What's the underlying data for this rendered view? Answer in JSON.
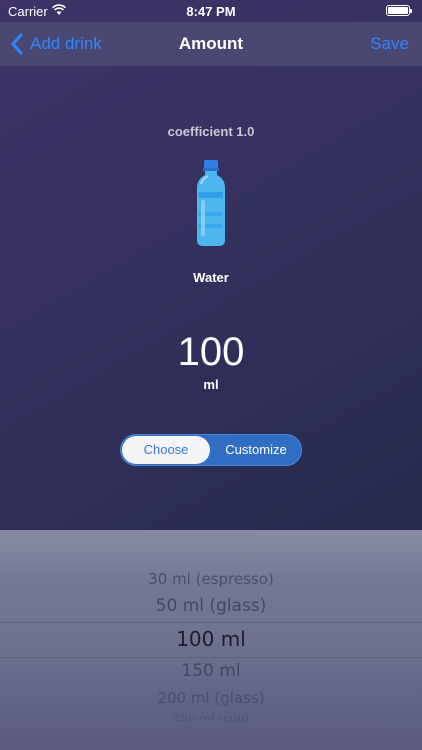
{
  "status_bar": {
    "carrier": "Carrier",
    "time": "8:47 PM"
  },
  "nav": {
    "back_label": "Add drink",
    "title": "Amount",
    "save_label": "Save"
  },
  "drink": {
    "coefficient": "coefficient 1.0",
    "name": "Water",
    "amount": "100",
    "unit": "ml"
  },
  "segmented": {
    "options": [
      "Choose",
      "Customize"
    ],
    "selected": "Choose"
  },
  "picker": {
    "items": [
      "30 ml (espresso)",
      "50 ml (glass)",
      "100 ml",
      "150 ml",
      "200 ml (glass)",
      "250 ml (cup)"
    ],
    "selected": "100 ml"
  },
  "colors": {
    "accent": "#2e86ff",
    "segment_bg": "#2f6ec4",
    "nav_bg": "#4a4873"
  }
}
